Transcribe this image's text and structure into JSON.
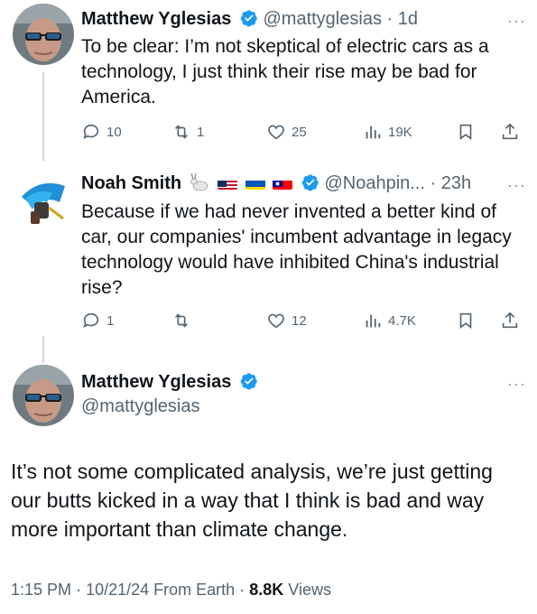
{
  "tweets": [
    {
      "author_name": "Matthew Yglesias",
      "handle": "@mattyglesias",
      "separator": "·",
      "time": "1d",
      "text": "To be clear: I’m not skeptical of electric cars as a technology, I just think their rise may be bad for America.",
      "replies": "10",
      "retweets": "1",
      "likes": "25",
      "views": "19K"
    },
    {
      "author_name": "Noah Smith",
      "handle": "@Noahpin...",
      "separator": "·",
      "time": "23h",
      "text": "Because if we had never invented a better kind of car, our companies' incumbent advantage in legacy technology would have inhibited China's industrial rise?",
      "replies": "1",
      "retweets": "",
      "likes": "12",
      "views": "4.7K"
    }
  ],
  "main_tweet": {
    "author_name": "Matthew Yglesias",
    "handle": "@mattyglesias",
    "text": "It’s not some complicated analysis, we’re just getting our butts kicked in a way that I think is bad and way more important than climate change.",
    "time": "1:15 PM",
    "separator": "·",
    "date": "10/21/24",
    "source": "From Earth",
    "separator2": "·",
    "views_count": "8.8K",
    "views_label": "Views"
  },
  "more_label": "···",
  "colors": {
    "verified_blue": "#1d9bf0",
    "muted": "#536471",
    "thread_line": "#cfd9de"
  },
  "icons": [
    "reply-icon",
    "retweet-icon",
    "like-icon",
    "views-icon",
    "bookmark-icon",
    "share-icon",
    "verified-icon",
    "rabbit-emoji",
    "us-flag",
    "ukraine-flag",
    "taiwan-flag"
  ]
}
